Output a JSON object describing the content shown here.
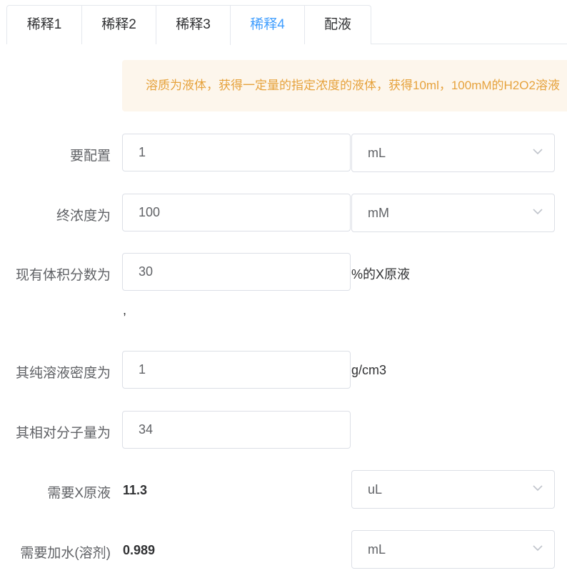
{
  "tabs": [
    {
      "label": "稀释1",
      "active": false
    },
    {
      "label": "稀释2",
      "active": false
    },
    {
      "label": "稀释3",
      "active": false
    },
    {
      "label": "稀释4",
      "active": true
    },
    {
      "label": "配液",
      "active": false
    }
  ],
  "alert": {
    "text": "溶质为液体，获得一定量的指定浓度的液体，获得10ml，100mM的H2O2溶液"
  },
  "form": {
    "volume": {
      "label": "要配置",
      "value": "1",
      "unit": "mL"
    },
    "concentration": {
      "label": "终浓度为",
      "value": "100",
      "unit": "mM"
    },
    "volume_fraction": {
      "label": "现有体积分数为",
      "value": "30",
      "suffix": "%的X原液",
      "separator": ","
    },
    "density": {
      "label": "其纯溶液密度为",
      "value": "1",
      "suffix": "g/cm3"
    },
    "molecular_weight": {
      "label": "其相对分子量为",
      "value": "34"
    },
    "stock_needed": {
      "label": "需要X原液",
      "value": "11.3",
      "unit": "uL"
    },
    "water_needed": {
      "label": "需要加水(溶剂)",
      "value": "0.989",
      "unit": "mL"
    }
  },
  "colors": {
    "accent": "#409eff",
    "warning_text": "#e6a23c",
    "warning_bg": "#fdf6ec",
    "border": "#dcdfe6"
  },
  "icons": {
    "select_arrow": "chevron-down-icon"
  }
}
